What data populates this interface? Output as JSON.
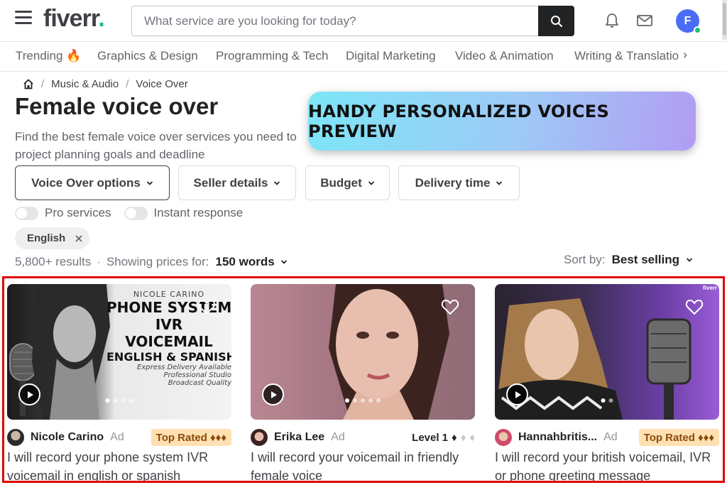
{
  "header": {
    "logo": "fiverr",
    "logo_dot": ".",
    "search_placeholder": "What service are you looking for today?",
    "avatar_initial": "F",
    "icons": [
      "menu-icon",
      "search-icon",
      "bell-icon",
      "mail-icon"
    ]
  },
  "categories": [
    {
      "label": "Trending 🔥"
    },
    {
      "label": "Graphics & Design"
    },
    {
      "label": "Programming & Tech"
    },
    {
      "label": "Digital Marketing"
    },
    {
      "label": "Video & Animation"
    },
    {
      "label": "Writing & Translatio"
    }
  ],
  "breadcrumb": {
    "items": [
      "Music & Audio",
      "Voice Over"
    ]
  },
  "page": {
    "title": "Female voice over",
    "description_1": "Find the best female voice over services you need to",
    "description_2": "project planning goals and deadline"
  },
  "banner": {
    "text": "HANDY PERSONALIZED VOICES PREVIEW"
  },
  "filters": [
    {
      "label": "Voice Over options"
    },
    {
      "label": "Seller details"
    },
    {
      "label": "Budget"
    },
    {
      "label": "Delivery time"
    }
  ],
  "toggles": [
    {
      "label": "Pro services"
    },
    {
      "label": "Instant response"
    }
  ],
  "chip": {
    "label": "English"
  },
  "results": {
    "count": "5,800+ results",
    "showing_label": "Showing prices for:",
    "showing_value": "150 words"
  },
  "sort": {
    "label": "Sort by:",
    "value": "Best selling"
  },
  "cards": [
    {
      "seller": "Nicole Carino",
      "ad": "Ad",
      "badge": "Top Rated ♦♦♦",
      "title_1": "I will record your phone system IVR",
      "title_2": "voicemail in english or spanish",
      "thumb_text": {
        "name": "NICOLE CARINO",
        "line1": "PHONE SYSTEM",
        "line2": "IVR",
        "line3": "VOICEMAIL",
        "line4": "ENGLISH & SPANISH",
        "f1": "Express Delivery Available",
        "f2": "Professional Studio",
        "f3": "Broadcast Quality"
      }
    },
    {
      "seller": "Erika Lee",
      "ad": "Ad",
      "badge": "Level 1",
      "title_1": "I will record your voicemail in friendly",
      "title_2": "female voice"
    },
    {
      "seller": "Hannahbritis...",
      "ad": "Ad",
      "badge": "Top Rated ♦♦♦",
      "title_1": "I will record your british voicemail, IVR",
      "title_2": "or phone greeting message",
      "thumb_corner": "fiverr"
    }
  ],
  "colors": {
    "brand_green": "#1dbf73",
    "highlight_border": "#e00000",
    "top_rated_bg": "#ffe0b3",
    "banner_gradient_start": "#7de6f7",
    "banner_gradient_end": "#b29cf3"
  }
}
